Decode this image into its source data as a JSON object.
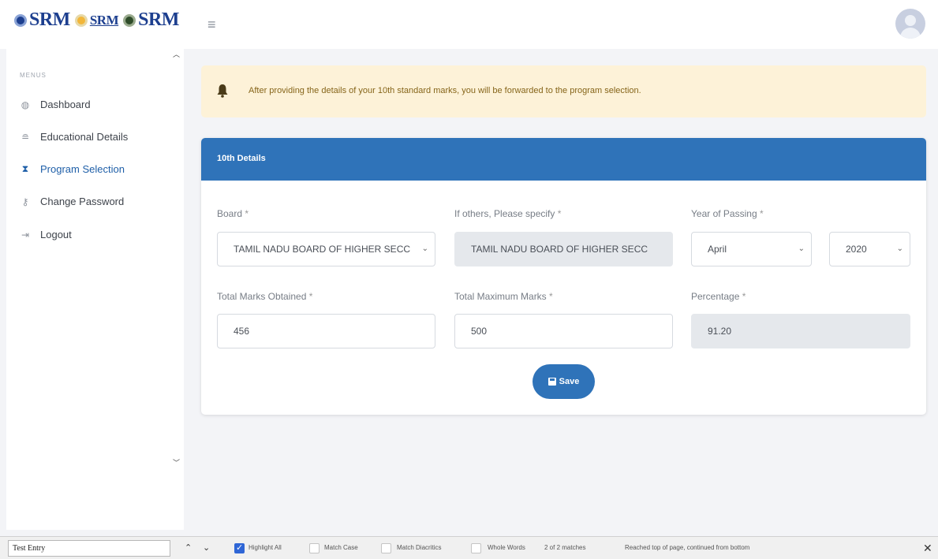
{
  "header": {
    "logos": [
      "SRM",
      "SRM",
      "SRM"
    ],
    "menu_icon": "hamburger-icon",
    "avatar_icon": "user-avatar-icon"
  },
  "sidebar": {
    "section_label": "MENUS",
    "items": [
      {
        "label": "Dashboard",
        "icon": "dashboard-icon",
        "active": false
      },
      {
        "label": "Educational Details",
        "icon": "graduation-cap-icon",
        "active": false
      },
      {
        "label": "Program Selection",
        "icon": "hourglass-icon",
        "active": true
      },
      {
        "label": "Change Password",
        "icon": "key-icon",
        "active": false
      },
      {
        "label": "Logout",
        "icon": "logout-icon",
        "active": false
      }
    ]
  },
  "alert": {
    "icon": "bell-icon",
    "message": "After providing the details of your 10th standard marks, you will be forwarded to the program selection."
  },
  "form": {
    "title": "10th Details",
    "board_label": "Board",
    "board_value": "TAMIL NADU BOARD OF HIGHER SECC",
    "others_label": "If others, Please specify",
    "others_value": "TAMIL NADU BOARD OF HIGHER SECC",
    "year_label": "Year of Passing",
    "month_value": "April",
    "year_value": "2020",
    "obtained_label": "Total Marks Obtained",
    "obtained_value": "456",
    "maximum_label": "Total Maximum Marks",
    "maximum_value": "500",
    "percentage_label": "Percentage",
    "percentage_value": "91.20",
    "required_mark": "*",
    "save_label": "Save"
  },
  "findbar": {
    "query": "Test Entry",
    "highlight_all": "Highlight All",
    "match_case": "Match Case",
    "match_diacritics": "Match Diacritics",
    "whole_words": "Whole Words",
    "match_count": "2 of 2 matches",
    "status": "Reached top of page, continued from bottom",
    "highlight_all_checked": true
  },
  "colors": {
    "primary": "#2f73b9",
    "alert_bg": "#fdf2d8",
    "active_nav": "#1f5fa8"
  }
}
